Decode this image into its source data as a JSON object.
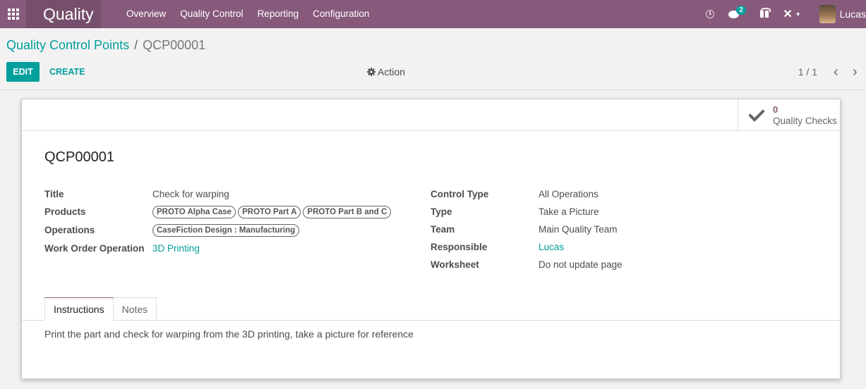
{
  "navbar": {
    "brand": "Quality",
    "menu": [
      "Overview",
      "Quality Control",
      "Reporting",
      "Configuration"
    ],
    "chat_badge": "2",
    "user_name": "Lucas"
  },
  "control_panel": {
    "breadcrumb_parent": "Quality Control Points",
    "breadcrumb_separator": "/",
    "breadcrumb_current": "QCP00001",
    "edit_label": "EDIT",
    "create_label": "CREATE",
    "action_label": "Action",
    "pager": "1 / 1"
  },
  "smart_button": {
    "value": "0",
    "label": "Quality Checks"
  },
  "record": {
    "name": "QCP00001",
    "left_fields": {
      "title_label": "Title",
      "title_value": "Check for warping",
      "products_label": "Products",
      "products": [
        "PROTO Alpha Case",
        "PROTO Part A",
        "PROTO Part B and C"
      ],
      "operations_label": "Operations",
      "operations": [
        "CaseFiction Design : Manufacturing"
      ],
      "work_order_label": "Work Order Operation",
      "work_order_value": "3D Printing"
    },
    "right_fields": {
      "control_type_label": "Control Type",
      "control_type_value": "All Operations",
      "type_label": "Type",
      "type_value": "Take a Picture",
      "team_label": "Team",
      "team_value": "Main Quality Team",
      "responsible_label": "Responsible",
      "responsible_value": "Lucas",
      "worksheet_label": "Worksheet",
      "worksheet_value": "Do not update page"
    }
  },
  "tabs": {
    "items": [
      "Instructions",
      "Notes"
    ],
    "active": "Instructions",
    "content": "Print the part and check for warping from the 3D printing, take a picture for reference"
  },
  "colors": {
    "navbar": "#875a7b",
    "accent": "#00a09d"
  }
}
